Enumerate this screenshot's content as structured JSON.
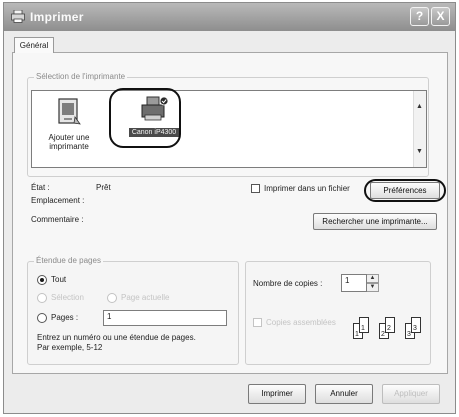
{
  "window": {
    "title": "Imprimer",
    "help_label": "?",
    "close_label": "X"
  },
  "tabs": [
    {
      "label": "Général"
    }
  ],
  "printer_selection": {
    "legend": "Sélection de l'imprimante",
    "items": [
      {
        "label_line1": "Ajouter une",
        "label_line2": "imprimante",
        "icon": "add-printer-icon"
      },
      {
        "label": "Canon iP4300",
        "icon": "printer-icon"
      }
    ],
    "scroll_up": "▲",
    "scroll_down": "▼"
  },
  "status": {
    "state_label": "État :",
    "state_value": "Prêt",
    "location_label": "Emplacement :",
    "comment_label": "Commentaire :",
    "print_to_file_label": "Imprimer dans un fichier",
    "preferences_button": "Préférences",
    "find_printer_button": "Rechercher une imprimante..."
  },
  "page_range": {
    "legend": "Étendue de pages",
    "all_label": "Tout",
    "selection_label": "Sélection",
    "current_page_label": "Page actuelle",
    "pages_label": "Pages :",
    "pages_value": "1",
    "hint_line1": "Entrez un numéro ou une étendue de pages.",
    "hint_line2": "Par exemple, 5-12"
  },
  "copies": {
    "count_label": "Nombre de copies :",
    "count_value": "1",
    "collate_label": "Copies assemblées",
    "collate_pages": [
      "1",
      "1",
      "2",
      "2",
      "3",
      "3"
    ]
  },
  "footer": {
    "print_button": "Imprimer",
    "cancel_button": "Annuler",
    "apply_button": "Appliquer"
  }
}
